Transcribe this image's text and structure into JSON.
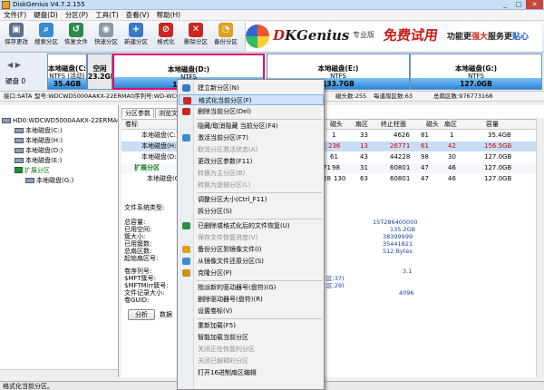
{
  "window": {
    "title": "DiskGenius V4.7.2.155",
    "btn_min": "_",
    "btn_max": "□",
    "btn_close": "✕"
  },
  "menu": [
    "文件(F)",
    "硬盘(D)",
    "分区(P)",
    "工具(T)",
    "查看(V)",
    "帮助(H)"
  ],
  "toolbar": [
    {
      "label": "保存更改",
      "icon": "save-icon",
      "color": "#5a6f8c"
    },
    {
      "label": "搜索分区",
      "icon": "search-icon",
      "color": "#3a8bd0"
    },
    {
      "label": "恢复文件",
      "icon": "recover-icon",
      "color": "#2c8a4a"
    },
    {
      "label": "快速分区",
      "icon": "disk-icon",
      "color": "#8a98a8"
    },
    {
      "label": "新建分区",
      "icon": "new-partition-icon",
      "color": "#3a78c8"
    },
    {
      "label": "格式化",
      "icon": "format-icon",
      "color": "#c8281f"
    },
    {
      "label": "删除分区",
      "icon": "delete-icon",
      "color": "#c8281f"
    },
    {
      "label": "备份分区",
      "icon": "backup-icon",
      "color": "#e0a020"
    }
  ],
  "banner": {
    "brand_d": "D",
    "brand_rest": "KGenius",
    "sub": "专业版",
    "free": "免费试用",
    "promo_a": "功能更",
    "promo_b": "强大",
    "promo_c": "服务更",
    "promo_d": "贴心"
  },
  "disk": {
    "label": "硬盘 0",
    "nav": "◀ ▶",
    "partitions": [
      {
        "name": "本地磁盘(C:",
        "fs": "NTFS (活动)",
        "size": "35.4GB"
      },
      {
        "name": "空闲",
        "fs": "",
        "size": "23.2GB"
      },
      {
        "name": "本地磁盘(D:)",
        "fs": "NTFS",
        "size": "127.0GB"
      },
      {
        "name": "本地磁盘(E:)",
        "fs": "NTFS",
        "size": "133.7GB"
      },
      {
        "name": "本地磁盘(G:)",
        "fs": "NTFS",
        "size": "127.0GB"
      }
    ]
  },
  "infobar": {
    "iface": "接口:SATA",
    "model": "型号:WDCWD5000AAKX-22ERMA0",
    "serial": "序列号:WD-WCC",
    "heads": "磁头数:255",
    "spt": "每道扇区数:63",
    "total": "总扇区数:976773168"
  },
  "tree": {
    "root": "HD0:WDCWD5000AAKX-22ERMA0",
    "items": [
      "本地磁盘(C:)",
      "本地磁盘(H:)",
      "本地磁盘(D:)",
      "本地磁盘(E:)",
      "扩展分区",
      "本地磁盘(G:)"
    ]
  },
  "tabs": [
    "分区参数",
    "浏览文"
  ],
  "grid": {
    "headers": [
      "卷标",
      "磁头",
      "扇区",
      "终止柱面",
      "磁头",
      "扇区",
      "容量"
    ],
    "rows": [
      {
        "label": "本地磁盘(C:)",
        "c1": "1",
        "c2": "33",
        "c3": "4626",
        "c4": "81",
        "c5": "1",
        "size": "35.4GB"
      },
      {
        "label": "本地磁盘(H:)",
        "c1": "236",
        "c2": "13",
        "c3": "26771",
        "c4": "61",
        "c5": "42",
        "size": "156.5GB"
      },
      {
        "label": "本地磁盘(D:)",
        "c1": "61",
        "c2": "43",
        "c3": "44228",
        "c4": "98",
        "c5": "30",
        "size": "127.0GB"
      },
      {
        "label": "扩展分区",
        "c1": "98",
        "c2": "31",
        "c3": "60801",
        "c4": "47",
        "c5": "46",
        "size": "127.0GB"
      },
      {
        "label": "本地磁盘(G:)",
        "c1": "130",
        "c2": "63",
        "c3": "60801",
        "c4": "47",
        "c5": "46",
        "size": "127.0GB"
      }
    ],
    "row_prefix": [
      "",
      "",
      "",
      "71",
      "28"
    ]
  },
  "details": {
    "fstype_label": "文件系统类型:",
    "labels": [
      "总容量:",
      "已用空间:",
      "簇大小:",
      "已用簇数:",
      "总扇区数:",
      "起始扇区号:"
    ],
    "values": [
      "15T286400000",
      "135.2GB",
      "38399999",
      "35441821",
      "512 Bytes"
    ],
    "labels2": [
      "卷序列号:",
      "$MFT簇号:",
      "$MFTMirr簇号:",
      "文件记录大小:",
      "卷GUID:"
    ],
    "values2": [
      "3.1",
      "区:37)",
      "区:29)",
      "4096"
    ],
    "analyze": "分析",
    "datalabel": "数据"
  },
  "status": "格式化当前分区。",
  "context_menu": [
    {
      "label": "建立新分区(N)",
      "state": "normal",
      "icon": "new-partition-icon",
      "color": "#3a78c8"
    },
    {
      "label": "格式化当前分区(F)",
      "state": "highlight",
      "icon": "format-icon",
      "color": "#c8281f"
    },
    {
      "label": "删除当前分区(Del)",
      "state": "normal",
      "icon": "delete-icon",
      "color": "#c8281f"
    },
    {
      "label": "隐藏/取消隐藏 当前分区(F4)",
      "state": "normal",
      "icon": "",
      "color": ""
    },
    {
      "label": "激活当前分区(F7)",
      "state": "normal",
      "icon": "activate-icon",
      "color": "#3a8bd0"
    },
    {
      "label": "取消分区激活状态(A)",
      "state": "disabled",
      "icon": "",
      "color": ""
    },
    {
      "label": "更改分区参数(F11)",
      "state": "normal",
      "icon": "",
      "color": ""
    },
    {
      "label": "转换为主分区(B)",
      "state": "disabled",
      "icon": "",
      "color": ""
    },
    {
      "label": "转换为逻辑分区(L)",
      "state": "disabled",
      "icon": "",
      "color": ""
    },
    {
      "label": "调整分区大小(Ctrl_F11)",
      "state": "normal",
      "icon": "",
      "color": ""
    },
    {
      "label": "拆分分区(S)",
      "state": "normal",
      "icon": "",
      "color": ""
    },
    {
      "label": "已删除或格式化后的文件恢复(U)",
      "state": "normal",
      "icon": "recover-icon",
      "color": "#2c8a4a"
    },
    {
      "label": "保存文件恢复进度(V)",
      "state": "disabled",
      "icon": "",
      "color": ""
    },
    {
      "label": "备份分区到镜像文件(I)",
      "state": "normal",
      "icon": "backup-icon",
      "color": "#e0a020"
    },
    {
      "label": "从镜像文件还原分区(S)",
      "state": "normal",
      "icon": "restore-icon",
      "color": "#3a8bd0"
    },
    {
      "label": "克隆分区(P)",
      "state": "normal",
      "icon": "clone-icon",
      "color": "#c89020"
    },
    {
      "label": "指派新的驱动器号(盘符)(G)",
      "state": "normal",
      "icon": "",
      "color": ""
    },
    {
      "label": "删除驱动器号(盘符)(R)",
      "state": "normal",
      "icon": "",
      "color": ""
    },
    {
      "label": "设置卷标(V)",
      "state": "normal",
      "icon": "",
      "color": ""
    },
    {
      "label": "重新加载(F5)",
      "state": "normal",
      "icon": "",
      "color": ""
    },
    {
      "label": "智能加载当前分区",
      "state": "normal",
      "icon": "",
      "color": ""
    },
    {
      "label": "关闭正在恢复的分区",
      "state": "disabled",
      "icon": "",
      "color": ""
    },
    {
      "label": "关闭已解释的分区",
      "state": "disabled",
      "icon": "",
      "color": ""
    },
    {
      "label": "打开16进制扇区编辑",
      "state": "normal",
      "icon": "",
      "color": ""
    }
  ]
}
